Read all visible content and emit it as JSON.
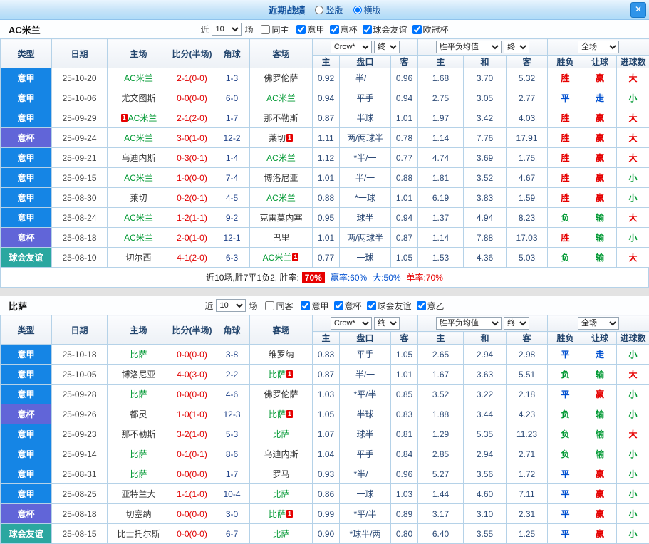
{
  "colors": {
    "league_serie_a": "#1585e5",
    "league_coppa": "#6165d8",
    "league_friendly": "#2aa7a0",
    "result_win_red": "#e60000",
    "result_draw_blue": "#0050d0",
    "result_lose_green": "#009933",
    "score_red": "#e00000",
    "focal_team_green": "#009933",
    "titlebar_button_blue": "#2f94e9"
  },
  "league_colors": {
    "a": "#1585e5",
    "b": "#6165d8",
    "f": "#2aa7a0"
  },
  "titlebar": {
    "title": "近期战绩",
    "vertical_label": "竖版",
    "horizontal_label": "横版",
    "close_label": "✕"
  },
  "table_header": {
    "left_cols": [
      "类型",
      "日期",
      "主场",
      "比分(半场)",
      "角球",
      "客场"
    ],
    "crow_select": "Crow*",
    "final_select": "终",
    "avg_select": "胜平负均值",
    "full_select": "全场",
    "odds_cols": [
      "主",
      "盘口",
      "客"
    ],
    "avg_cols": [
      "主",
      "和",
      "客"
    ],
    "result_cols": [
      "胜负",
      "让球",
      "进球数"
    ]
  },
  "sections": [
    {
      "team": "AC米兰",
      "filter": {
        "near": "近",
        "count": "10",
        "games": "场",
        "same": "同主",
        "leagues": [
          {
            "label": "意甲",
            "checked": true
          },
          {
            "label": "意杯",
            "checked": true
          },
          {
            "label": "球会友谊",
            "checked": true
          },
          {
            "label": "欧冠杯",
            "checked": true
          }
        ]
      },
      "rows": [
        {
          "lg": "意甲",
          "lgc": "a",
          "date": "25-10-20",
          "h": "AC米兰",
          "hg": true,
          "s": "2-1(0-0)",
          "c": "1-3",
          "a": "佛罗伦萨",
          "ag": false,
          "o": [
            "0.92",
            "半/一",
            "0.96"
          ],
          "v": [
            "1.68",
            "3.70",
            "5.32"
          ],
          "r": [
            [
              "胜",
              "red"
            ],
            [
              "赢",
              "red"
            ],
            [
              "大",
              "red"
            ]
          ]
        },
        {
          "lg": "意甲",
          "lgc": "a",
          "date": "25-10-06",
          "h": "尤文图斯",
          "hg": false,
          "s": "0-0(0-0)",
          "c": "6-0",
          "a": "AC米兰",
          "ag": true,
          "o": [
            "0.94",
            "平手",
            "0.94"
          ],
          "v": [
            "2.75",
            "3.05",
            "2.77"
          ],
          "r": [
            [
              "平",
              "blue"
            ],
            [
              "走",
              "blue"
            ],
            [
              "小",
              "green"
            ]
          ]
        },
        {
          "lg": "意甲",
          "lgc": "a",
          "date": "25-09-29",
          "hp": "1",
          "h": "AC米兰",
          "hg": true,
          "s": "2-1(2-0)",
          "c": "1-7",
          "a": "那不勒斯",
          "ag": false,
          "o": [
            "0.87",
            "半球",
            "1.01"
          ],
          "v": [
            "1.97",
            "3.42",
            "4.03"
          ],
          "r": [
            [
              "胜",
              "red"
            ],
            [
              "赢",
              "red"
            ],
            [
              "大",
              "red"
            ]
          ]
        },
        {
          "lg": "意杯",
          "lgc": "b",
          "date": "25-09-24",
          "h": "AC米兰",
          "hg": true,
          "s": "3-0(1-0)",
          "c": "12-2",
          "a": "莱切",
          "as": "1",
          "ag": false,
          "o": [
            "1.11",
            "两/两球半",
            "0.78"
          ],
          "v": [
            "1.14",
            "7.76",
            "17.91"
          ],
          "r": [
            [
              "胜",
              "red"
            ],
            [
              "赢",
              "red"
            ],
            [
              "大",
              "red"
            ]
          ]
        },
        {
          "lg": "意甲",
          "lgc": "a",
          "date": "25-09-21",
          "h": "乌迪内斯",
          "hg": false,
          "s": "0-3(0-1)",
          "c": "1-4",
          "a": "AC米兰",
          "ag": true,
          "o": [
            "1.12",
            "*半/一",
            "0.77"
          ],
          "v": [
            "4.74",
            "3.69",
            "1.75"
          ],
          "r": [
            [
              "胜",
              "red"
            ],
            [
              "赢",
              "red"
            ],
            [
              "大",
              "red"
            ]
          ]
        },
        {
          "lg": "意甲",
          "lgc": "a",
          "date": "25-09-15",
          "h": "AC米兰",
          "hg": true,
          "s": "1-0(0-0)",
          "c": "7-4",
          "a": "博洛尼亚",
          "ag": false,
          "o": [
            "1.01",
            "半/一",
            "0.88"
          ],
          "v": [
            "1.81",
            "3.52",
            "4.67"
          ],
          "r": [
            [
              "胜",
              "red"
            ],
            [
              "赢",
              "red"
            ],
            [
              "小",
              "green"
            ]
          ]
        },
        {
          "lg": "意甲",
          "lgc": "a",
          "date": "25-08-30",
          "h": "莱切",
          "hg": false,
          "s": "0-2(0-1)",
          "c": "4-5",
          "a": "AC米兰",
          "ag": true,
          "o": [
            "0.88",
            "*一球",
            "1.01"
          ],
          "v": [
            "6.19",
            "3.83",
            "1.59"
          ],
          "r": [
            [
              "胜",
              "red"
            ],
            [
              "赢",
              "red"
            ],
            [
              "小",
              "green"
            ]
          ]
        },
        {
          "lg": "意甲",
          "lgc": "a",
          "date": "25-08-24",
          "h": "AC米兰",
          "hg": true,
          "s": "1-2(1-1)",
          "c": "9-2",
          "a": "克雷莫内塞",
          "ag": false,
          "o": [
            "0.95",
            "球半",
            "0.94"
          ],
          "v": [
            "1.37",
            "4.94",
            "8.23"
          ],
          "r": [
            [
              "负",
              "green"
            ],
            [
              "输",
              "green"
            ],
            [
              "大",
              "red"
            ]
          ]
        },
        {
          "lg": "意杯",
          "lgc": "b",
          "date": "25-08-18",
          "h": "AC米兰",
          "hg": true,
          "s": "2-0(1-0)",
          "c": "12-1",
          "a": "巴里",
          "ag": false,
          "o": [
            "1.01",
            "两/两球半",
            "0.87"
          ],
          "v": [
            "1.14",
            "7.88",
            "17.03"
          ],
          "r": [
            [
              "胜",
              "red"
            ],
            [
              "输",
              "green"
            ],
            [
              "小",
              "green"
            ]
          ]
        },
        {
          "lg": "球会友谊",
          "lgc": "f",
          "date": "25-08-10",
          "h": "切尔西",
          "hg": false,
          "s": "4-1(2-0)",
          "c": "6-3",
          "a": "AC米兰",
          "as": "1",
          "ag": true,
          "o": [
            "0.77",
            "一球",
            "1.05"
          ],
          "v": [
            "1.53",
            "4.36",
            "5.03"
          ],
          "r": [
            [
              "负",
              "green"
            ],
            [
              "输",
              "green"
            ],
            [
              "大",
              "red"
            ]
          ]
        }
      ],
      "summary": {
        "prefix": "近10场,胜7平1负2, 胜率:",
        "win_rate": "70%",
        "stats": [
          {
            "text": "赢率:60%",
            "color": "blue"
          },
          {
            "text": "大:50%",
            "color": "blue"
          },
          {
            "text": "单率:70%",
            "color": "red"
          }
        ]
      }
    },
    {
      "team": "比萨",
      "filter": {
        "near": "近",
        "count": "10",
        "games": "场",
        "same": "同客",
        "leagues": [
          {
            "label": "意甲",
            "checked": true
          },
          {
            "label": "意杯",
            "checked": true
          },
          {
            "label": "球会友谊",
            "checked": true
          },
          {
            "label": "意乙",
            "checked": true
          }
        ]
      },
      "rows": [
        {
          "lg": "意甲",
          "lgc": "a",
          "date": "25-10-18",
          "h": "比萨",
          "hg": true,
          "s": "0-0(0-0)",
          "c": "3-8",
          "a": "维罗纳",
          "ag": false,
          "o": [
            "0.83",
            "平手",
            "1.05"
          ],
          "v": [
            "2.65",
            "2.94",
            "2.98"
          ],
          "r": [
            [
              "平",
              "blue"
            ],
            [
              "走",
              "blue"
            ],
            [
              "小",
              "green"
            ]
          ]
        },
        {
          "lg": "意甲",
          "lgc": "a",
          "date": "25-10-05",
          "h": "博洛尼亚",
          "hg": false,
          "s": "4-0(3-0)",
          "c": "2-2",
          "a": "比萨",
          "as": "1",
          "ag": true,
          "o": [
            "0.87",
            "半/一",
            "1.01"
          ],
          "v": [
            "1.67",
            "3.63",
            "5.51"
          ],
          "r": [
            [
              "负",
              "green"
            ],
            [
              "输",
              "green"
            ],
            [
              "大",
              "red"
            ]
          ]
        },
        {
          "lg": "意甲",
          "lgc": "a",
          "date": "25-09-28",
          "h": "比萨",
          "hg": true,
          "s": "0-0(0-0)",
          "c": "4-6",
          "a": "佛罗伦萨",
          "ag": false,
          "o": [
            "1.03",
            "*平/半",
            "0.85"
          ],
          "v": [
            "3.52",
            "3.22",
            "2.18"
          ],
          "r": [
            [
              "平",
              "blue"
            ],
            [
              "赢",
              "red"
            ],
            [
              "小",
              "green"
            ]
          ]
        },
        {
          "lg": "意杯",
          "lgc": "b",
          "date": "25-09-26",
          "h": "都灵",
          "hg": false,
          "s": "1-0(1-0)",
          "c": "12-3",
          "a": "比萨",
          "as": "1",
          "ag": true,
          "o": [
            "1.05",
            "半球",
            "0.83"
          ],
          "v": [
            "1.88",
            "3.44",
            "4.23"
          ],
          "r": [
            [
              "负",
              "green"
            ],
            [
              "输",
              "green"
            ],
            [
              "小",
              "green"
            ]
          ]
        },
        {
          "lg": "意甲",
          "lgc": "a",
          "date": "25-09-23",
          "h": "那不勒斯",
          "hg": false,
          "s": "3-2(1-0)",
          "c": "5-3",
          "a": "比萨",
          "ag": true,
          "o": [
            "1.07",
            "球半",
            "0.81"
          ],
          "v": [
            "1.29",
            "5.35",
            "11.23"
          ],
          "r": [
            [
              "负",
              "green"
            ],
            [
              "输",
              "green"
            ],
            [
              "大",
              "red"
            ]
          ]
        },
        {
          "lg": "意甲",
          "lgc": "a",
          "date": "25-09-14",
          "h": "比萨",
          "hg": true,
          "s": "0-1(0-1)",
          "c": "8-6",
          "a": "乌迪内斯",
          "ag": false,
          "o": [
            "1.04",
            "平手",
            "0.84"
          ],
          "v": [
            "2.85",
            "2.94",
            "2.71"
          ],
          "r": [
            [
              "负",
              "green"
            ],
            [
              "输",
              "green"
            ],
            [
              "小",
              "green"
            ]
          ]
        },
        {
          "lg": "意甲",
          "lgc": "a",
          "date": "25-08-31",
          "h": "比萨",
          "hg": true,
          "s": "0-0(0-0)",
          "c": "1-7",
          "a": "罗马",
          "ag": false,
          "o": [
            "0.93",
            "*半/一",
            "0.96"
          ],
          "v": [
            "5.27",
            "3.56",
            "1.72"
          ],
          "r": [
            [
              "平",
              "blue"
            ],
            [
              "赢",
              "red"
            ],
            [
              "小",
              "green"
            ]
          ]
        },
        {
          "lg": "意甲",
          "lgc": "a",
          "date": "25-08-25",
          "h": "亚特兰大",
          "hg": false,
          "s": "1-1(1-0)",
          "c": "10-4",
          "a": "比萨",
          "ag": true,
          "o": [
            "0.86",
            "一球",
            "1.03"
          ],
          "v": [
            "1.44",
            "4.60",
            "7.11"
          ],
          "r": [
            [
              "平",
              "blue"
            ],
            [
              "赢",
              "red"
            ],
            [
              "小",
              "green"
            ]
          ]
        },
        {
          "lg": "意杯",
          "lgc": "b",
          "date": "25-08-18",
          "h": "切塞纳",
          "hg": false,
          "s": "0-0(0-0)",
          "c": "3-0",
          "a": "比萨",
          "as": "1",
          "ag": true,
          "o": [
            "0.99",
            "*平/半",
            "0.89"
          ],
          "v": [
            "3.17",
            "3.10",
            "2.31"
          ],
          "r": [
            [
              "平",
              "blue"
            ],
            [
              "赢",
              "red"
            ],
            [
              "小",
              "green"
            ]
          ]
        },
        {
          "lg": "球会友谊",
          "lgc": "f",
          "date": "25-08-15",
          "h": "比士托尔斯",
          "hg": false,
          "s": "0-0(0-0)",
          "c": "6-7",
          "a": "比萨",
          "ag": true,
          "o": [
            "0.90",
            "*球半/两",
            "0.80"
          ],
          "v": [
            "6.40",
            "3.55",
            "1.25"
          ],
          "r": [
            [
              "平",
              "blue"
            ],
            [
              "赢",
              "red"
            ],
            [
              "小",
              "green"
            ]
          ]
        }
      ]
    }
  ]
}
